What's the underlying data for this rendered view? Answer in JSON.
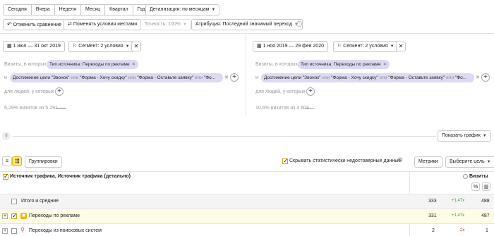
{
  "periods": [
    "Сегодня",
    "Вчера",
    "Неделя",
    "Месяц",
    "Квартал",
    "Год"
  ],
  "detail_select": "Детализация: по месяцам",
  "toolbar": {
    "cancel_compare": "Отменить сравнение",
    "swap_conditions": "Поменять условия местами",
    "accuracy": "Точность: 100%",
    "attribution": "Атрибуция: Последний значимый переход"
  },
  "left": {
    "date_range": "1 июл — 31 окт 2019",
    "segment": "Сегмент: 2 условия",
    "visits_label": "Визиты, в которых",
    "source_pill": "Тип источника: Переходы по рекламе",
    "and_label": "и",
    "goal_prefix": "Достижение цели",
    "goal_1": "\"Звонок\"",
    "or": "или",
    "goal_2": "\"Форма - Хочу скидку\"",
    "goal_3": "\"Форма - Оставьте заявку\"",
    "goal_4": "\"Фо...",
    "people_label": "для людей, у которых",
    "summary": "6,29% визитов из 5 291"
  },
  "right": {
    "date_range": "1 ноя 2019 — 29 фев 2020",
    "segment": "Сегмент: 2 условия",
    "visits_label": "Визиты, в которых",
    "source_pill": "Тип источника: Переходы по рекламе",
    "and_label": "и",
    "goal_prefix": "Достижение цели",
    "goal_1": "\"Звонок\"",
    "or": "или",
    "goal_2": "\"Форма - Хочу скидку\"",
    "goal_3": "\"Форма - Оставьте заявку\"",
    "goal_4": "\"Фо...",
    "people_label": "для людей, у которых",
    "summary": "10,6% визитов из 4 603"
  },
  "show_chart": "Показать график",
  "table_toolbar": {
    "groupings": "Группировки",
    "hide_unreliable": "Скрывать статистически недостоверные данные",
    "metrics": "Метрики",
    "choose_goal": "Выберите цель"
  },
  "table": {
    "header": "Источник трафика, Источник трафика (детально)",
    "metric_header": "Визиты",
    "pct_symbol": "%",
    "rows": [
      {
        "label": "Итого и средние",
        "v1": "333",
        "ratio": "+1,47x",
        "v2": "488"
      },
      {
        "label": "Переходы по рекламе",
        "v1": "331",
        "ratio": "+1,47x",
        "v2": "487"
      },
      {
        "label": "Переходы из поисковых систем",
        "v1": "2",
        "ratio": "-2x",
        "v2": "1"
      }
    ]
  },
  "colors": {
    "accent_yellow": "#ffdb4d",
    "pill_bg": "#dcdaf2",
    "positive_green": "#3a9a3a",
    "negative_red": "#c0392b"
  }
}
